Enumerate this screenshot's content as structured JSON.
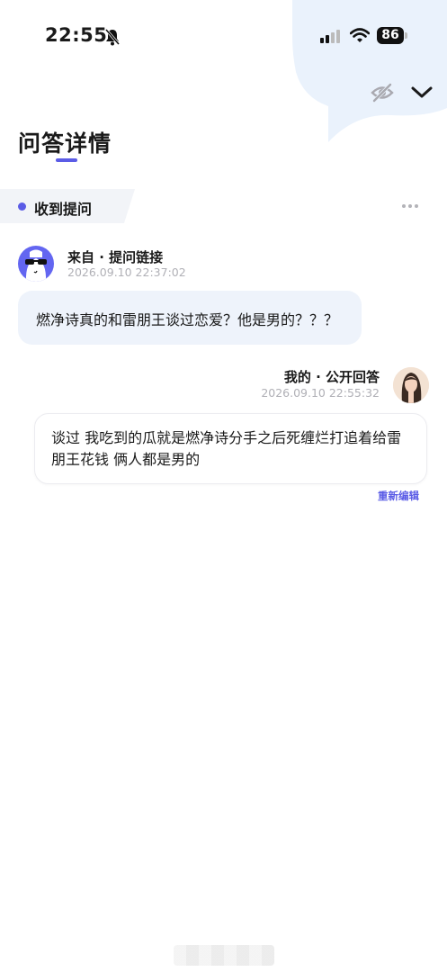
{
  "status_bar": {
    "time": "22:55",
    "battery": "86",
    "icons": [
      "bell-muted-icon",
      "cellular-signal-icon",
      "wifi-icon",
      "battery-icon"
    ]
  },
  "header": {
    "title": "问答详情",
    "actions": [
      "eye-off-icon",
      "chevron-down-icon"
    ]
  },
  "section": {
    "label": "收到提问",
    "more": "more-dots-icon"
  },
  "question": {
    "sender": "来自 · 提问链接",
    "timestamp": "2026.09.10 22:37:02",
    "text": "燃净诗真的和雷朋王谈过恋爱？他是男的？？？"
  },
  "answer": {
    "sender": "我的 · 公开回答",
    "timestamp": "2026.09.10 22:55:32",
    "text": "谈过 我吃到的瓜就是燃净诗分手之后死缠烂打追着给雷朋王花钱 俩人都是男的",
    "edit_label": "重新编辑"
  },
  "colors": {
    "accent": "#5b5ce6",
    "question_bg": "#eef3fb",
    "decor_bg": "#eaf2fc",
    "muted_text": "#b0b0b6"
  }
}
